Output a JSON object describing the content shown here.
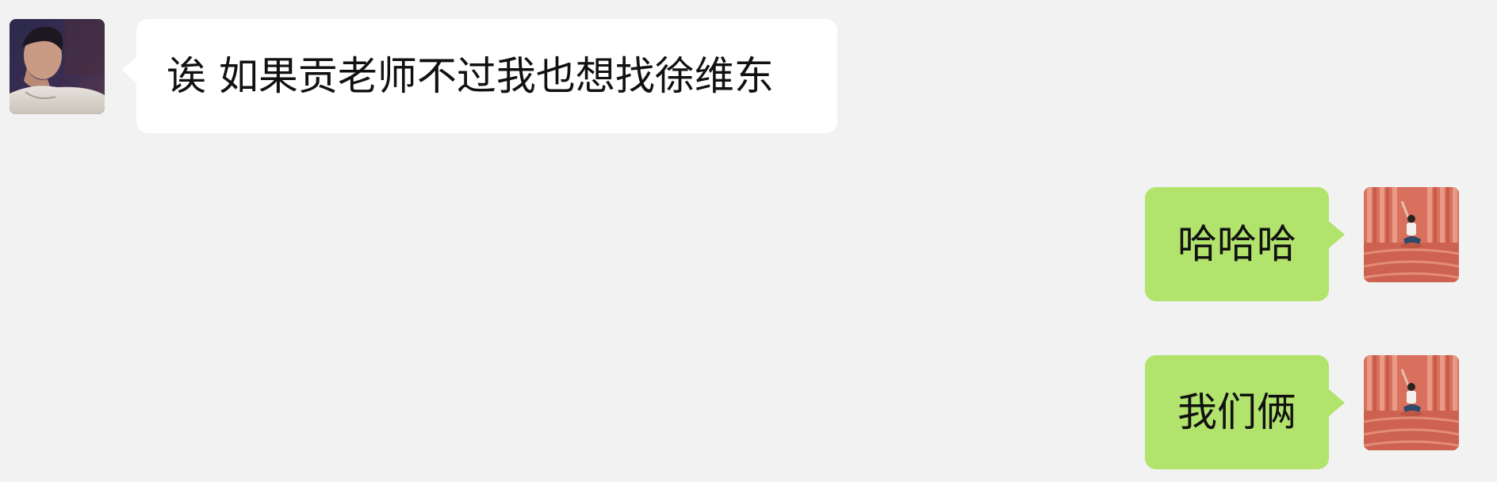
{
  "chat": {
    "messages": [
      {
        "direction": "incoming",
        "text": "诶 如果贡老师不过我也想找徐维东",
        "avatar_icon": "contact-portrait-avatar"
      },
      {
        "direction": "outgoing",
        "text": "哈哈哈",
        "avatar_icon": "self-red-wall-avatar"
      },
      {
        "direction": "outgoing",
        "text": "我们俩",
        "avatar_icon": "self-red-wall-avatar"
      }
    ]
  },
  "colors": {
    "background": "#f2f2f2",
    "incoming_bubble": "#ffffff",
    "outgoing_bubble": "#b2e36d",
    "text": "#111111"
  }
}
